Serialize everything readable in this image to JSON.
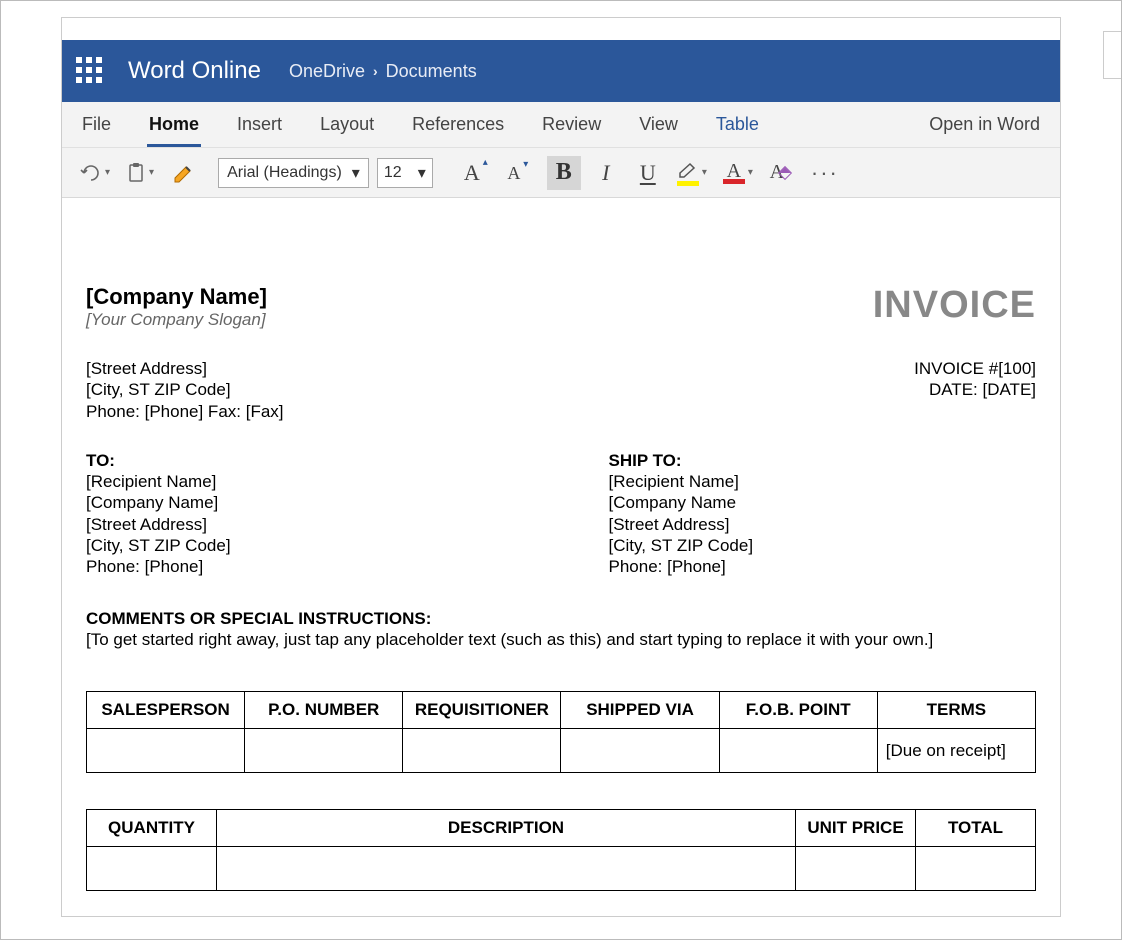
{
  "header": {
    "app_title": "Word Online",
    "breadcrumb": {
      "root": "OneDrive",
      "leaf": "Documents"
    }
  },
  "menu": {
    "file": "File",
    "home": "Home",
    "insert": "Insert",
    "layout": "Layout",
    "references": "References",
    "review": "Review",
    "view": "View",
    "table": "Table",
    "open_in_word": "Open in Word"
  },
  "toolbar": {
    "font_name": "Arial (Headings)",
    "font_size": "12"
  },
  "doc": {
    "company_name": "[Company Name]",
    "slogan": "[Your Company Slogan]",
    "invoice_title": "INVOICE",
    "street": "[Street Address]",
    "city": "[City, ST ZIP Code]",
    "phone_fax": "Phone: [Phone]  Fax: [Fax]",
    "invoice_no": "INVOICE #[100]",
    "invoice_date": "DATE: [DATE]",
    "to": {
      "label": "TO:",
      "name": "[Recipient Name]",
      "company": "[Company Name]",
      "street": "[Street Address]",
      "city": "[City, ST ZIP Code]",
      "phone": "Phone: [Phone]"
    },
    "shipto": {
      "label": "SHIP TO:",
      "name": "[Recipient Name]",
      "company": "[Company Name",
      "street": "[Street Address]",
      "city": "[City, ST ZIP Code]",
      "phone": "Phone: [Phone]"
    },
    "comments_label": "COMMENTS OR SPECIAL INSTRUCTIONS:",
    "comments_text": "[To get started right away, just tap any placeholder text (such as this) and start typing to replace it with your own.]",
    "table1": {
      "headers": {
        "salesperson": "SALESPERSON",
        "po": "P.O. NUMBER",
        "req": "REQUISITIONER",
        "shipped": "SHIPPED VIA",
        "fob": "F.O.B. POINT",
        "terms": "TERMS"
      },
      "row": {
        "salesperson": "",
        "po": "",
        "req": "",
        "shipped": "",
        "fob": "",
        "terms": "[Due on receipt]"
      }
    },
    "table2": {
      "headers": {
        "qty": "QUANTITY",
        "desc": "DESCRIPTION",
        "unit": "UNIT PRICE",
        "total": "TOTAL"
      }
    }
  }
}
